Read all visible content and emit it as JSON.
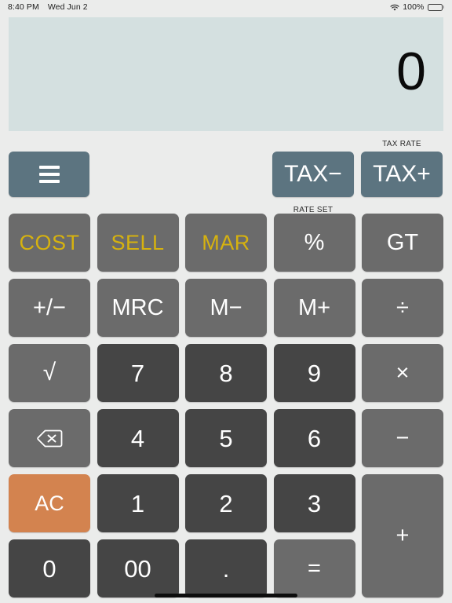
{
  "status_bar": {
    "time": "8:40 PM",
    "date": "Wed Jun 2",
    "wifi_icon": "wifi-icon",
    "battery_percent": "100%",
    "battery_icon": "battery-icon"
  },
  "display": {
    "value": "0"
  },
  "function_row": {
    "menu_icon": "hamburger-menu-icon",
    "tax_minus_label": "TAX−",
    "tax_plus_label": "TAX+",
    "tax_rate_label": "TAX RATE"
  },
  "labels": {
    "rate_set": "RATE SET"
  },
  "keys": [
    {
      "id": "cost",
      "label": "COST",
      "style": "func",
      "col": 0,
      "row": 0
    },
    {
      "id": "sell",
      "label": "SELL",
      "style": "func",
      "col": 1,
      "row": 0
    },
    {
      "id": "mar",
      "label": "MAR",
      "style": "func",
      "col": 2,
      "row": 0
    },
    {
      "id": "percent",
      "label": "%",
      "style": "op",
      "col": 3,
      "row": 0
    },
    {
      "id": "gt",
      "label": "GT",
      "style": "op",
      "col": 4,
      "row": 0
    },
    {
      "id": "plusminus",
      "label": "+/−",
      "style": "op",
      "col": 0,
      "row": 1
    },
    {
      "id": "mrc",
      "label": "MRC",
      "style": "op",
      "col": 1,
      "row": 1
    },
    {
      "id": "mminus",
      "label": "M−",
      "style": "op",
      "col": 2,
      "row": 1
    },
    {
      "id": "mplus",
      "label": "M+",
      "style": "op",
      "col": 3,
      "row": 1
    },
    {
      "id": "divide",
      "label": "÷",
      "style": "op",
      "col": 4,
      "row": 1
    },
    {
      "id": "sqrt",
      "label": "√",
      "style": "op",
      "col": 0,
      "row": 2
    },
    {
      "id": "seven",
      "label": "7",
      "style": "num",
      "col": 1,
      "row": 2
    },
    {
      "id": "eight",
      "label": "8",
      "style": "num",
      "col": 2,
      "row": 2
    },
    {
      "id": "nine",
      "label": "9",
      "style": "num",
      "col": 3,
      "row": 2
    },
    {
      "id": "multiply",
      "label": "×",
      "style": "op",
      "col": 4,
      "row": 2
    },
    {
      "id": "backspace",
      "label": "",
      "style": "icon",
      "col": 0,
      "row": 3,
      "icon": "backspace-icon"
    },
    {
      "id": "four",
      "label": "4",
      "style": "num",
      "col": 1,
      "row": 3
    },
    {
      "id": "five",
      "label": "5",
      "style": "num",
      "col": 2,
      "row": 3
    },
    {
      "id": "six",
      "label": "6",
      "style": "num",
      "col": 3,
      "row": 3
    },
    {
      "id": "minus",
      "label": "−",
      "style": "op",
      "col": 4,
      "row": 3
    },
    {
      "id": "ac",
      "label": "AC",
      "style": "ac",
      "col": 0,
      "row": 4
    },
    {
      "id": "one",
      "label": "1",
      "style": "num",
      "col": 1,
      "row": 4
    },
    {
      "id": "two",
      "label": "2",
      "style": "num",
      "col": 2,
      "row": 4
    },
    {
      "id": "three",
      "label": "3",
      "style": "num",
      "col": 3,
      "row": 4
    },
    {
      "id": "plus",
      "label": "+",
      "style": "op",
      "col": 4,
      "row": 4,
      "rowspan": 2
    },
    {
      "id": "zero",
      "label": "0",
      "style": "num",
      "col": 0,
      "row": 5
    },
    {
      "id": "doublezero",
      "label": "00",
      "style": "num",
      "col": 1,
      "row": 5
    },
    {
      "id": "decimal",
      "label": ".",
      "style": "num",
      "col": 2,
      "row": 5
    },
    {
      "id": "equals",
      "label": "=",
      "style": "op",
      "col": 3,
      "row": 5
    }
  ],
  "colors": {
    "background": "#ebeceb",
    "display_bg": "#d4e0e0",
    "slate": "#5c7480",
    "gray": "#6b6b6b",
    "dark_gray": "#454545",
    "accent_orange": "#d3834f",
    "accent_gold": "#d6b20f"
  }
}
